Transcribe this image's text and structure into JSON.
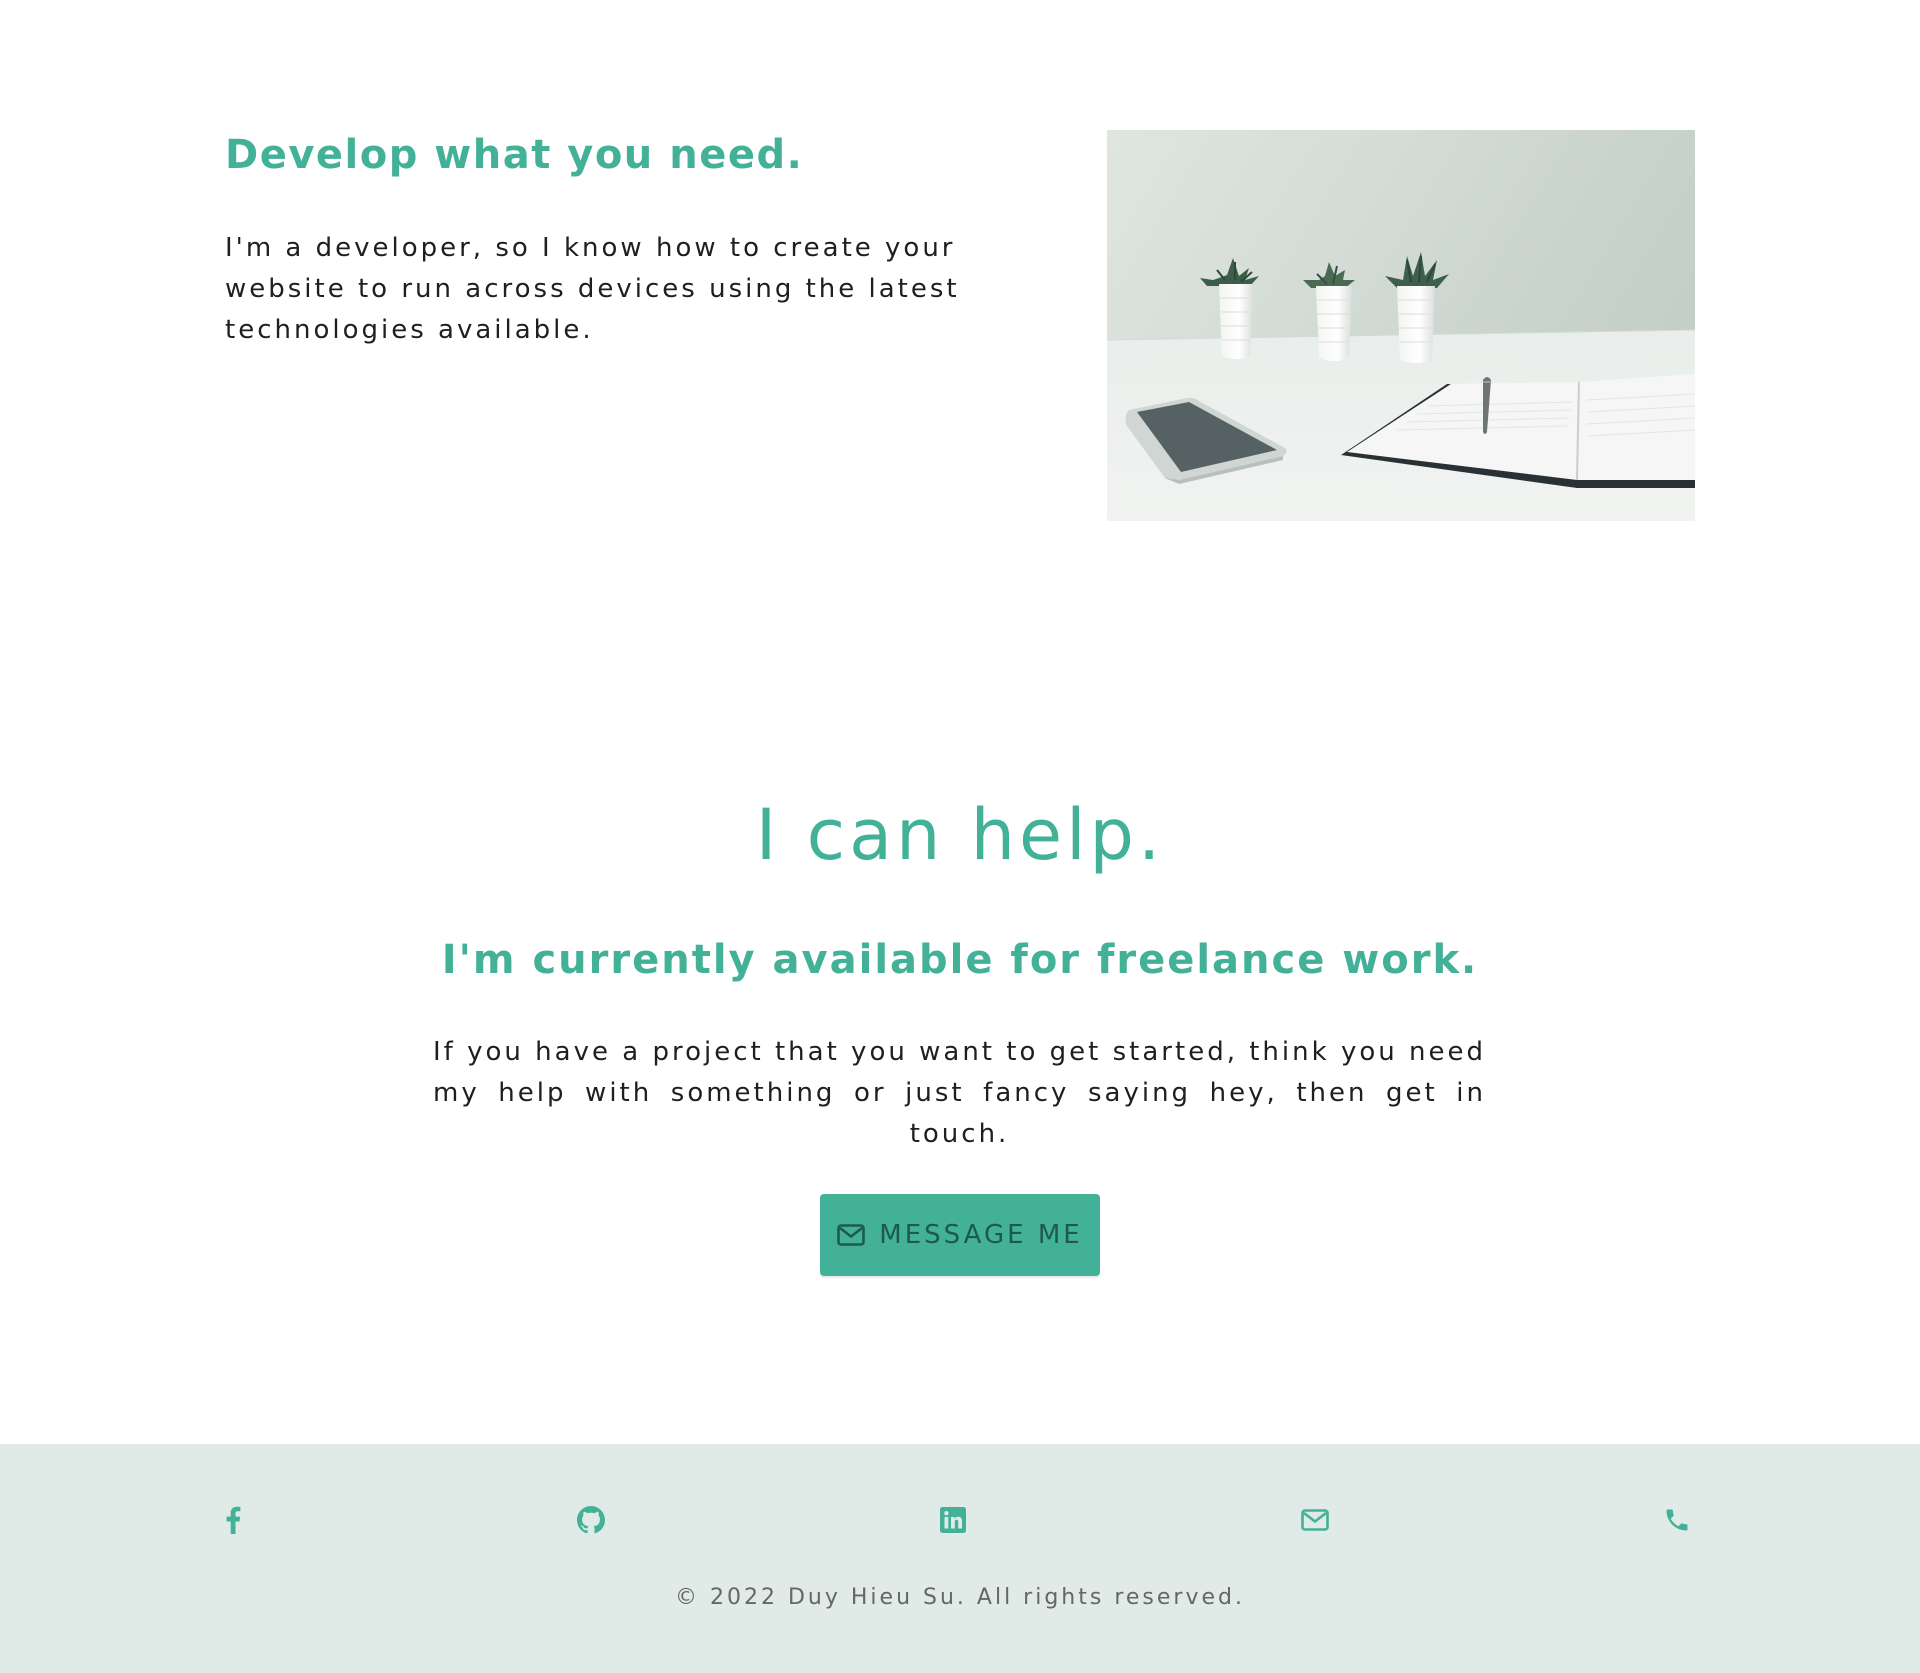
{
  "develop": {
    "title": "Develop what you need.",
    "text": "I'm a developer, so I know how to create your website to run across devices using the latest technologies available.",
    "image_alt": "White desk with three small potted succulents, a smartphone and an open notebook with a pen"
  },
  "help": {
    "title": "I can help.",
    "subtitle": "I'm currently available for freelance work.",
    "text": "If you have a project that you want to get started, think you need my help with something or just fancy saying hey, then get in touch.",
    "button_label": "MESSAGE ME",
    "button_icon": "envelope-icon"
  },
  "footer": {
    "social_links": [
      {
        "icon": "facebook-icon"
      },
      {
        "icon": "github-icon"
      },
      {
        "icon": "linkedin-icon"
      },
      {
        "icon": "envelope-icon"
      },
      {
        "icon": "phone-icon"
      }
    ],
    "copyright": "© 2022 Duy Hieu Su. All rights reserved."
  },
  "colors": {
    "accent": "#43b197",
    "button_text": "#1d5a4c",
    "footer_bg": "#e0eae6",
    "body_text": "#1f1f1f",
    "muted_text": "#666666"
  }
}
